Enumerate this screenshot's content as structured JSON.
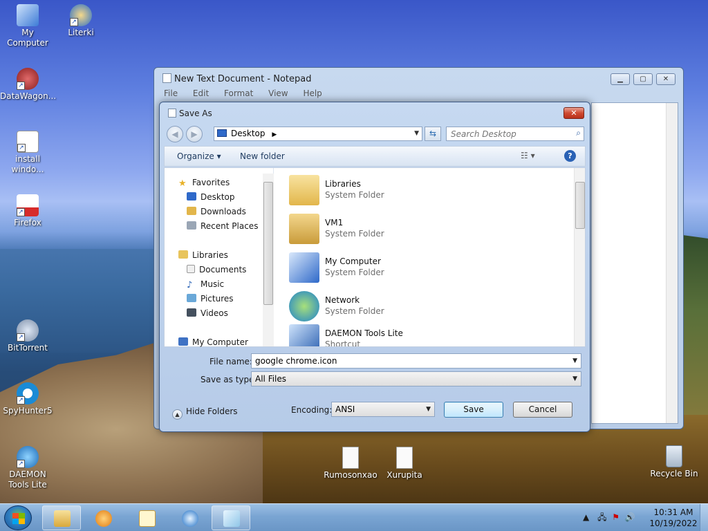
{
  "desktop": {
    "icons": [
      {
        "label": "My Computer",
        "icon": "computer-icon"
      },
      {
        "label": "Literki",
        "icon": "literki-icon"
      },
      {
        "label": "DataWagon...",
        "icon": "datawagon-icon"
      },
      {
        "label": "install windo...",
        "icon": "installer-icon"
      },
      {
        "label": "Firefox",
        "icon": "pdf-shortcut-icon"
      },
      {
        "label": "BitTorrent",
        "icon": "bittorrent-icon"
      },
      {
        "label": "SpyHunter5",
        "icon": "spyhunter-icon"
      },
      {
        "label": "DAEMON Tools Lite",
        "icon": "daemon-tools-icon"
      },
      {
        "label": "Rumosonxao",
        "icon": "text-file-icon"
      },
      {
        "label": "Xurupita",
        "icon": "text-file-icon"
      },
      {
        "label": "Recycle Bin",
        "icon": "recycle-bin-icon"
      }
    ]
  },
  "notepad": {
    "title": "New Text Document - Notepad",
    "menu": [
      "File",
      "Edit",
      "Format",
      "View",
      "Help"
    ]
  },
  "save_as": {
    "title": "Save As",
    "address": "Desktop",
    "search_placeholder": "Search Desktop",
    "toolbar": {
      "organize": "Organize ▾",
      "new_folder": "New folder"
    },
    "nav_pane": {
      "favorites": "Favorites",
      "favorites_items": [
        "Desktop",
        "Downloads",
        "Recent Places"
      ],
      "libraries": "Libraries",
      "libraries_items": [
        "Documents",
        "Music",
        "Pictures",
        "Videos"
      ],
      "my_computer": "My Computer"
    },
    "files": [
      {
        "name": "Libraries",
        "type": "System Folder",
        "icon": "libraries-folder-icon"
      },
      {
        "name": "VM1",
        "type": "System Folder",
        "icon": "user-folder-icon"
      },
      {
        "name": "My Computer",
        "type": "System Folder",
        "icon": "computer-icon"
      },
      {
        "name": "Network",
        "type": "System Folder",
        "icon": "network-icon"
      },
      {
        "name": "DAEMON Tools Lite",
        "type": "Shortcut",
        "icon": "daemon-tools-icon"
      }
    ],
    "file_name_label": "File name:",
    "file_name_value": "google chrome.icon",
    "save_type_label": "Save as type:",
    "save_type_value": "All Files",
    "encoding_label": "Encoding:",
    "encoding_value": "ANSI",
    "hide_folders": "Hide Folders",
    "save_button": "Save",
    "cancel_button": "Cancel"
  },
  "taskbar": {
    "time": "10:31 AM",
    "date": "10/19/2022"
  }
}
